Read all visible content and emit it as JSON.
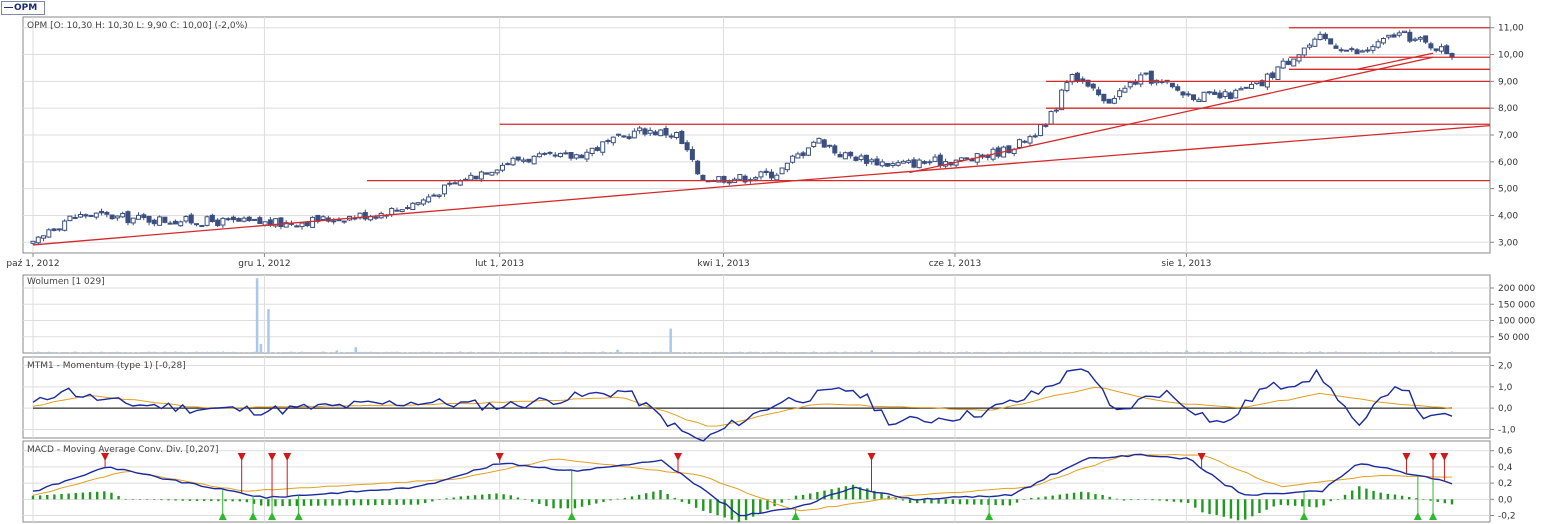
{
  "legend": {
    "symbol_label": "OPM"
  },
  "colors": {
    "candle_down": "#3a4f80",
    "candle_up": "#ffffff",
    "support_line": "#d42a2a",
    "volume": "#a9c9ec",
    "momentum": "#1a2a9e",
    "signal": "#e0a020",
    "macd_hist": "#1f9a1f",
    "sell_marker": "#d01818",
    "buy_marker": "#2eb82e",
    "grid": "#dddddd"
  },
  "panels": {
    "price": {
      "title": "OPM [O: 10,30  H: 10,30  L: 9,90  C: 10,00] (-2,0%)",
      "y_ticks": [
        "11,00",
        "10,00",
        "9,00",
        "8,00",
        "7,00",
        "6,00",
        "5,00",
        "4,00",
        "3,00"
      ]
    },
    "volume": {
      "title": "Wolumen [1 029]",
      "y_ticks": [
        "200 000",
        "150 000",
        "100 000",
        "50 000"
      ]
    },
    "momentum": {
      "title": "MTM1 - Momentum (type 1) [-0,28]",
      "y_ticks": [
        "2,0",
        "1,0",
        "0,0",
        "-1,0"
      ]
    },
    "macd": {
      "title": "MACD - Moving Average Conv. Div. [0,207]",
      "y_ticks": [
        "0,6",
        "0,4",
        "0,2",
        "0,0",
        "-0,2"
      ]
    }
  },
  "x_ticks": [
    "paź 1, 2012",
    "gru 1, 2012",
    "lut 1, 2013",
    "kwi 1, 2013",
    "cze 1, 2013",
    "sie 1, 2013"
  ],
  "chart_data": [
    {
      "type": "candlestick",
      "title": "OPM [O: 10,30  H: 10,30  L: 9,90  C: 10,00] (-2,0%)",
      "x_range": [
        "2012-10-01",
        "2013-10-10"
      ],
      "ylim": [
        2.6,
        11.4
      ],
      "last_candle": {
        "open": 10.3,
        "high": 10.3,
        "low": 9.9,
        "close": 10.0,
        "change_pct": -2.0
      },
      "close_series": [
        [
          "2012-10-01",
          2.9
        ],
        [
          "2012-10-05",
          3.5
        ],
        [
          "2012-10-10",
          3.9
        ],
        [
          "2012-10-15",
          4.05
        ],
        [
          "2012-10-25",
          3.9
        ],
        [
          "2012-11-10",
          3.8
        ],
        [
          "2012-11-25",
          3.75
        ],
        [
          "2012-12-05",
          3.7
        ],
        [
          "2012-12-20",
          3.9
        ],
        [
          "2013-01-01",
          4.1
        ],
        [
          "2013-01-10",
          4.5
        ],
        [
          "2013-01-20",
          5.2
        ],
        [
          "2013-01-28",
          5.7
        ],
        [
          "2013-02-05",
          6.1
        ],
        [
          "2013-02-20",
          6.2
        ],
        [
          "2013-03-01",
          6.7
        ],
        [
          "2013-03-10",
          7.2
        ],
        [
          "2013-03-20",
          7.0
        ],
        [
          "2013-03-25",
          5.4
        ],
        [
          "2013-04-05",
          5.4
        ],
        [
          "2013-04-15",
          5.6
        ],
        [
          "2013-04-25",
          6.9
        ],
        [
          "2013-05-01",
          6.3
        ],
        [
          "2013-05-15",
          5.9
        ],
        [
          "2013-05-25",
          6.0
        ],
        [
          "2013-06-05",
          6.1
        ],
        [
          "2013-06-15",
          6.5
        ],
        [
          "2013-06-25",
          7.4
        ],
        [
          "2013-07-01",
          9.4
        ],
        [
          "2013-07-10",
          8.2
        ],
        [
          "2013-07-20",
          9.2
        ],
        [
          "2013-08-01",
          8.5
        ],
        [
          "2013-08-10",
          8.4
        ],
        [
          "2013-08-20",
          8.9
        ],
        [
          "2013-08-28",
          9.9
        ],
        [
          "2013-09-05",
          10.6
        ],
        [
          "2013-09-15",
          10.0
        ],
        [
          "2013-09-25",
          10.8
        ],
        [
          "2013-10-05",
          10.3
        ],
        [
          "2013-10-10",
          10.0
        ]
      ],
      "horizontal_levels": [
        {
          "y": 11.0,
          "from": "2013-08-28",
          "to": "2013-10-10"
        },
        {
          "y": 9.9,
          "from": "2013-08-28",
          "to": "2013-10-10"
        },
        {
          "y": 9.45,
          "from": "2013-08-28",
          "to": "2013-10-10"
        },
        {
          "y": 9.0,
          "from": "2013-06-25",
          "to": "2013-10-10"
        },
        {
          "y": 8.0,
          "from": "2013-06-25",
          "to": "2013-10-10"
        },
        {
          "y": 7.4,
          "from": "2013-02-01",
          "to": "2013-10-10"
        },
        {
          "y": 5.3,
          "from": "2012-12-28",
          "to": "2013-10-10"
        }
      ],
      "trend_lines": [
        {
          "from": [
            "2012-10-01",
            2.9
          ],
          "to": [
            "2013-04-20",
            5.3
          ]
        },
        {
          "from": [
            "2013-04-20",
            5.3
          ],
          "to": [
            "2013-10-10",
            7.35
          ]
        },
        {
          "from": [
            "2013-05-20",
            5.6
          ],
          "to": [
            "2013-10-05",
            9.9
          ]
        },
        {
          "from": [
            "2013-09-15",
            9.45
          ],
          "to": [
            "2013-10-05",
            10.05
          ]
        }
      ]
    },
    {
      "type": "bar",
      "title": "Wolumen [1 029]",
      "ylim": [
        0,
        240000
      ],
      "last_value": 1029,
      "spikes": [
        [
          "2012-11-29",
          230000
        ],
        [
          "2012-11-30",
          28000
        ],
        [
          "2012-12-02",
          135000
        ],
        [
          "2012-12-20",
          8000
        ],
        [
          "2012-12-25",
          18000
        ],
        [
          "2013-03-18",
          75000
        ],
        [
          "2013-03-04",
          10000
        ],
        [
          "2013-05-10",
          8000
        ],
        [
          "2013-08-01",
          8000
        ]
      ]
    },
    {
      "type": "line",
      "title": "MTM1 - Momentum (type 1) [-0,28]",
      "ylim": [
        -1.4,
        2.4
      ],
      "last_value": -0.28,
      "series": [
        {
          "values": [
            [
              "2012-10-01",
              0.2
            ],
            [
              "2012-10-08",
              0.9
            ],
            [
              "2012-10-20",
              0.3
            ],
            [
              "2012-11-10",
              0.0
            ],
            [
              "2012-12-01",
              -0.1
            ],
            [
              "2013-01-10",
              0.3
            ],
            [
              "2013-02-01",
              0.1
            ],
            [
              "2013-03-05",
              0.8
            ],
            [
              "2013-03-25",
              -1.6
            ],
            [
              "2013-04-15",
              0.3
            ],
            [
              "2013-05-05",
              0.9
            ],
            [
              "2013-05-15",
              -0.7
            ],
            [
              "2013-06-05",
              -0.3
            ],
            [
              "2013-06-20",
              0.5
            ],
            [
              "2013-07-05",
              2.1
            ],
            [
              "2013-07-12",
              -0.3
            ],
            [
              "2013-07-25",
              0.8
            ],
            [
              "2013-08-10",
              -0.8
            ],
            [
              "2013-08-20",
              0.8
            ],
            [
              "2013-09-05",
              1.6
            ],
            [
              "2013-09-15",
              -1.0
            ],
            [
              "2013-09-25",
              1.3
            ],
            [
              "2013-10-03",
              -0.6
            ],
            [
              "2013-10-10",
              -0.28
            ]
          ]
        },
        {
          "values": [
            [
              "2012-10-01",
              0.1
            ],
            [
              "2012-10-15",
              0.6
            ],
            [
              "2012-11-15",
              0.0
            ],
            [
              "2013-01-20",
              0.2
            ],
            [
              "2013-03-05",
              0.5
            ],
            [
              "2013-03-28",
              -0.9
            ],
            [
              "2013-04-25",
              0.2
            ],
            [
              "2013-06-10",
              -0.1
            ],
            [
              "2013-07-08",
              1.0
            ],
            [
              "2013-07-25",
              0.3
            ],
            [
              "2013-08-15",
              0.0
            ],
            [
              "2013-09-05",
              0.7
            ],
            [
              "2013-09-25",
              0.2
            ],
            [
              "2013-10-10",
              0.0
            ]
          ]
        }
      ]
    },
    {
      "type": "line",
      "title": "MACD - Moving Average Conv. Div. [0,207]",
      "ylim": [
        -0.28,
        0.72
      ],
      "last_value": 0.207,
      "series": [
        {
          "values": [
            [
              "2012-10-01",
              0.1
            ],
            [
              "2012-10-20",
              0.4
            ],
            [
              "2012-11-10",
              0.2
            ],
            [
              "2012-12-01",
              0.02
            ],
            [
              "2013-01-10",
              0.15
            ],
            [
              "2013-02-01",
              0.45
            ],
            [
              "2013-02-20",
              0.35
            ],
            [
              "2013-03-15",
              0.48
            ],
            [
              "2013-04-05",
              -0.2
            ],
            [
              "2013-04-20",
              -0.1
            ],
            [
              "2013-05-05",
              0.15
            ],
            [
              "2013-05-20",
              0.0
            ],
            [
              "2013-06-15",
              0.05
            ],
            [
              "2013-07-05",
              0.5
            ],
            [
              "2013-07-20",
              0.55
            ],
            [
              "2013-08-01",
              0.5
            ],
            [
              "2013-08-15",
              0.05
            ],
            [
              "2013-09-05",
              0.1
            ],
            [
              "2013-09-15",
              0.45
            ],
            [
              "2013-10-10",
              0.2
            ]
          ]
        },
        {
          "values": [
            [
              "2012-10-01",
              0.05
            ],
            [
              "2012-10-25",
              0.35
            ],
            [
              "2012-11-25",
              0.1
            ],
            [
              "2013-01-20",
              0.25
            ],
            [
              "2013-02-15",
              0.5
            ],
            [
              "2013-03-25",
              0.3
            ],
            [
              "2013-04-20",
              -0.15
            ],
            [
              "2013-05-20",
              0.05
            ],
            [
              "2013-06-20",
              0.15
            ],
            [
              "2013-07-15",
              0.55
            ],
            [
              "2013-08-05",
              0.55
            ],
            [
              "2013-08-25",
              0.15
            ],
            [
              "2013-09-20",
              0.3
            ],
            [
              "2013-10-10",
              0.27
            ]
          ]
        }
      ],
      "sell_signals": [
        "2012-10-20",
        "2012-11-25",
        "2012-12-03",
        "2012-12-07",
        "2013-02-01",
        "2013-03-20",
        "2013-05-10",
        "2013-08-05",
        "2013-09-28",
        "2013-10-05",
        "2013-10-08"
      ],
      "buy_signals": [
        "2012-11-20",
        "2012-11-28",
        "2012-12-03",
        "2012-12-10",
        "2013-02-20",
        "2013-04-20",
        "2013-06-10",
        "2013-09-01",
        "2013-10-01",
        "2013-10-05"
      ]
    }
  ]
}
